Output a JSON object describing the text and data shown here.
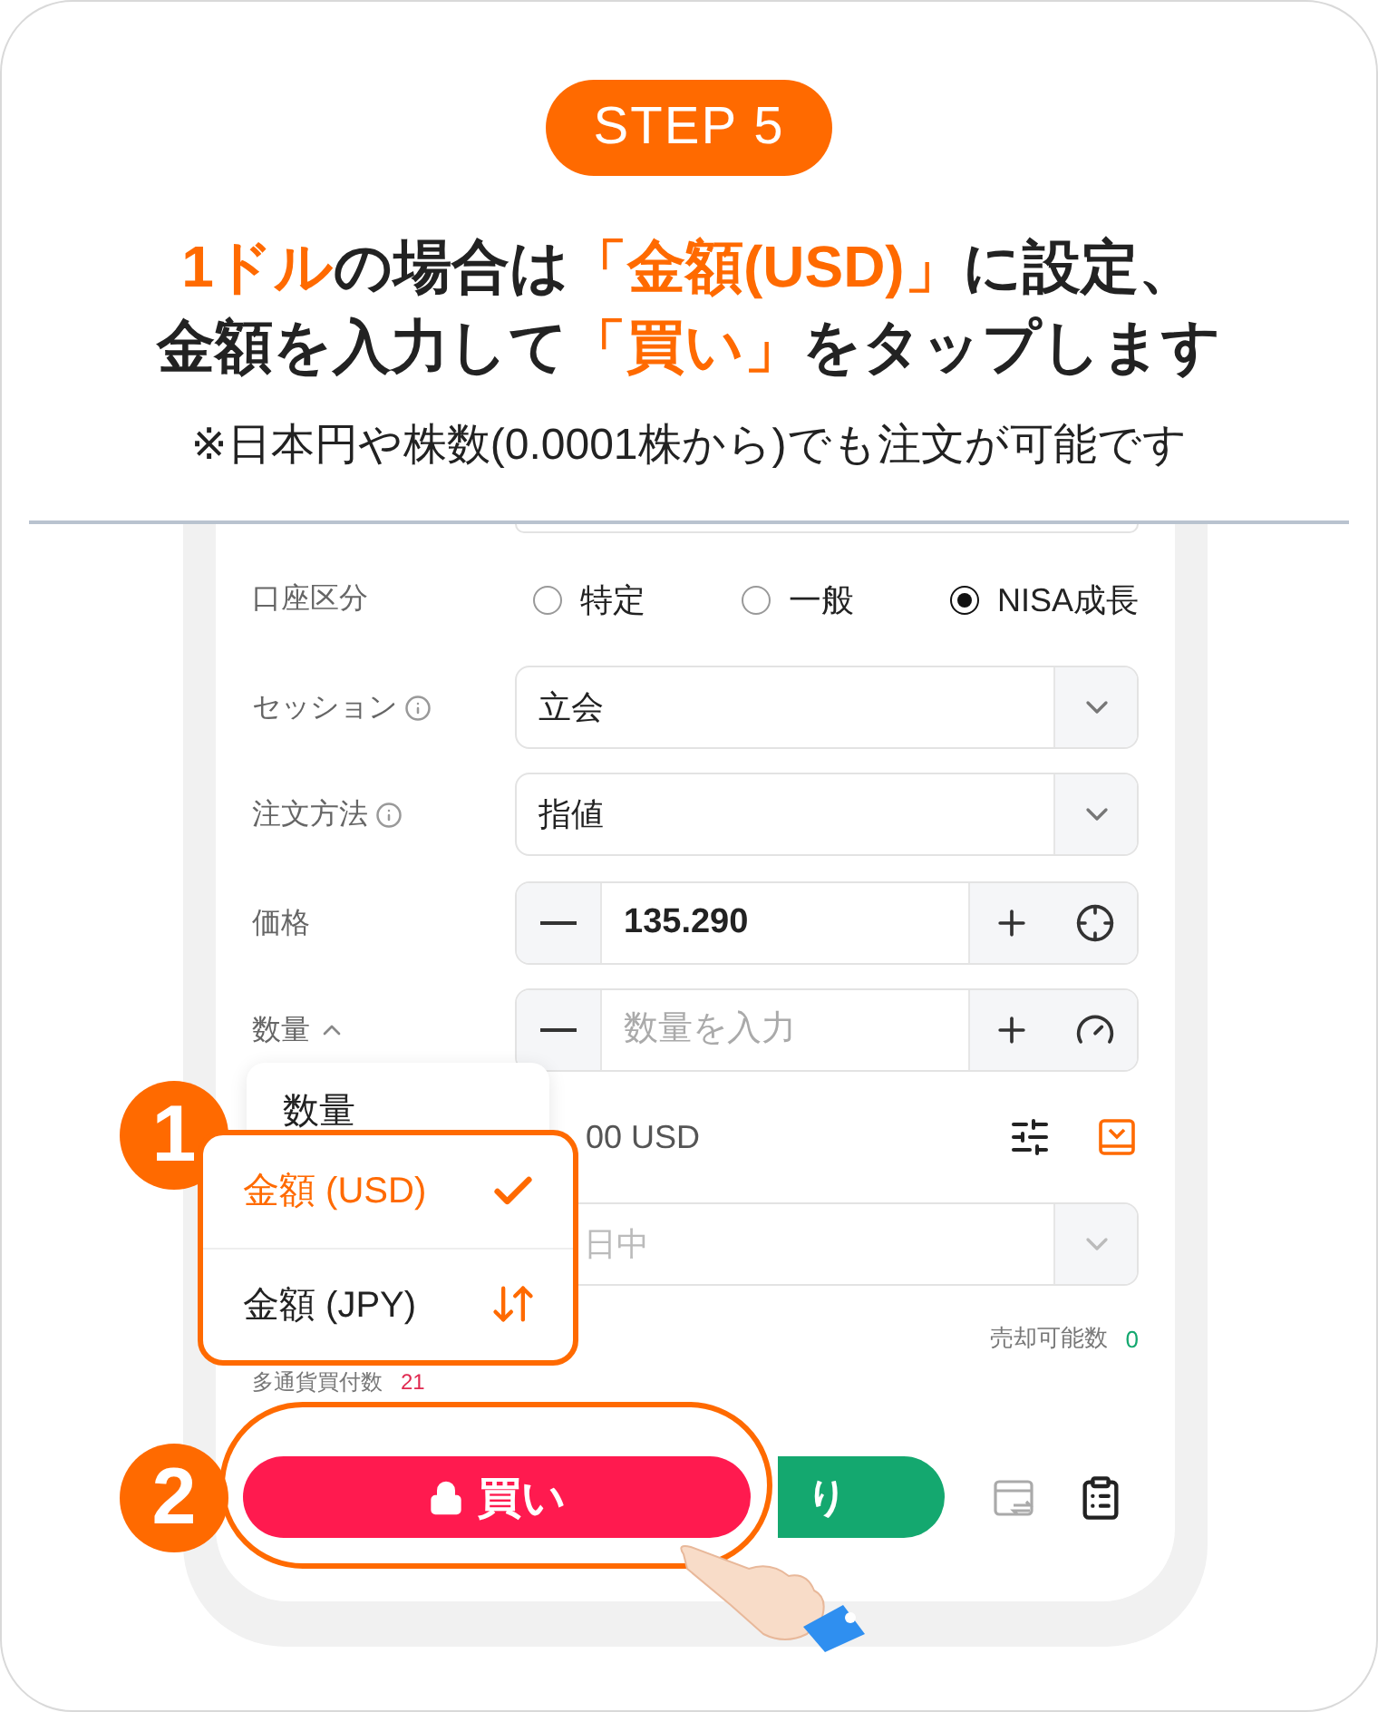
{
  "step_badge": "STEP 5",
  "headline": [
    [
      {
        "text": "1ドル",
        "accent": true
      },
      {
        "text": "の場合は",
        "accent": false
      },
      {
        "text": "「金額(USD)」",
        "accent": true
      },
      {
        "text": "に設定、",
        "accent": false
      }
    ],
    [
      {
        "text": "金額を入力して",
        "accent": false
      },
      {
        "text": "「買い」",
        "accent": true
      },
      {
        "text": "をタップします",
        "accent": false
      }
    ]
  ],
  "note": "※日本円や株数(0.0001株から)でも注文が可能です",
  "form": {
    "account_type": {
      "label": "口座区分",
      "options": [
        {
          "label": "特定",
          "selected": false
        },
        {
          "label": "一般",
          "selected": false
        },
        {
          "label": "NISA成長",
          "selected": true
        }
      ]
    },
    "session": {
      "label": "セッション",
      "value": "立会"
    },
    "order_method": {
      "label": "注文方法",
      "value": "指値"
    },
    "price": {
      "label": "価格",
      "value": "135.290"
    },
    "quantity": {
      "label": "数量",
      "placeholder": "数量を入力"
    },
    "amount": {
      "value": "00 USD"
    },
    "period": {
      "value": "日中",
      "disabled": true
    },
    "sellable": {
      "label": "売却可能数",
      "value": "0"
    },
    "multi_currency": {
      "label": "多通貨買付数",
      "value": "21"
    }
  },
  "unit_menu": [
    {
      "label": "数量",
      "selected": false
    },
    {
      "label": "金額 (USD)",
      "selected": true
    },
    {
      "label": "金額 (JPY)",
      "selected": false
    }
  ],
  "callouts": [
    "1",
    "2"
  ],
  "buttons": {
    "buy": "買い",
    "sell": "り"
  }
}
